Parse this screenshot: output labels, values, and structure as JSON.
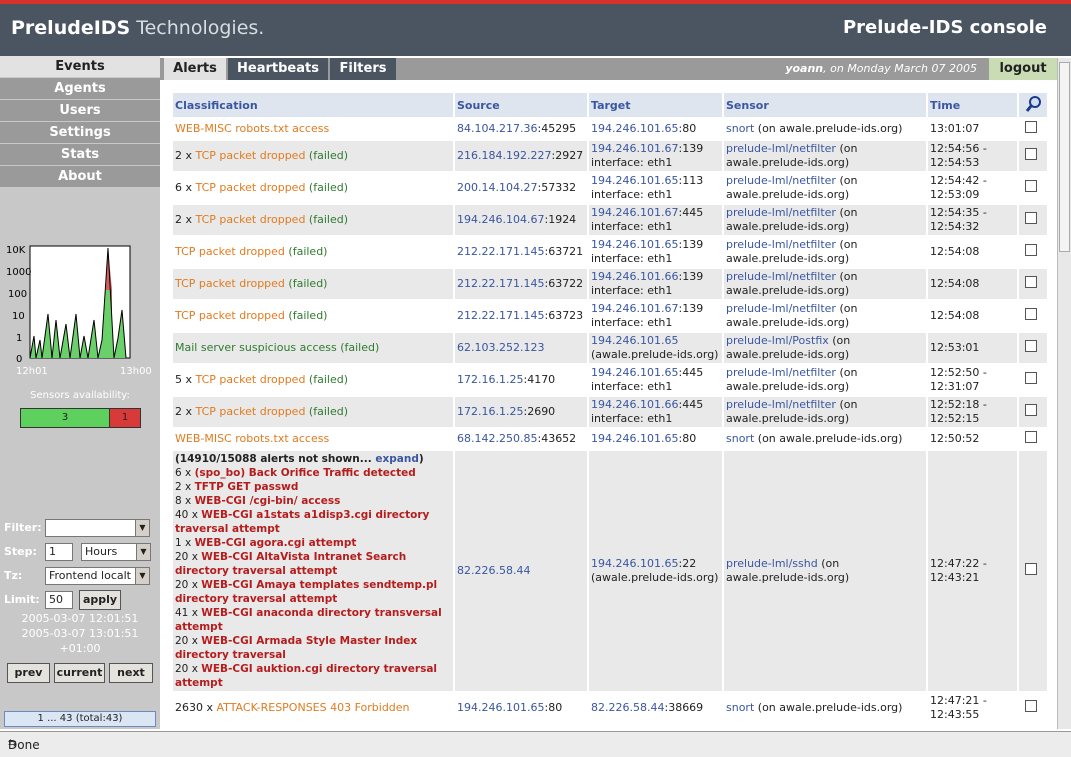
{
  "header": {
    "brand": "PreludeIDS",
    "brand_sub": "Technologies.",
    "console": "Prelude-IDS console"
  },
  "nav": [
    "Events",
    "Agents",
    "Users",
    "Settings",
    "Stats",
    "About"
  ],
  "graph": {
    "yticks": [
      "10K",
      "1000",
      "100",
      "10",
      "1",
      "0"
    ],
    "xstart": "12h01",
    "xend": "13h00"
  },
  "availability": {
    "label": "Sensors availability:",
    "ok": "3",
    "bad": "1"
  },
  "filters": {
    "filter_label": "Filter:",
    "filter_value": "",
    "step_label": "Step:",
    "step_value": "1",
    "step_unit": "Hours",
    "tz_label": "Tz:",
    "tz_value": "Frontend localt",
    "limit_label": "Limit:",
    "limit_value": "50",
    "apply": "apply",
    "date_from": "2005-03-07 12:01:51",
    "date_to": "2005-03-07 13:01:51",
    "tz_offset": "+01:00",
    "prev": "prev",
    "current": "current",
    "next": "next",
    "pager": "1 ... 43 (total:43)"
  },
  "tabs": [
    "Alerts",
    "Heartbeats",
    "Filters"
  ],
  "user": {
    "name": "yoann",
    "date": ", on Monday March 07 2005",
    "logout": "logout"
  },
  "columns": [
    "Classification",
    "Source",
    "Target",
    "Sensor",
    "Time"
  ],
  "rows": [
    {
      "cnt": "",
      "cls": "WEB-MISC robots.txt access",
      "failed": "",
      "src": "84.104.217.36",
      "sport": ":45295",
      "tgt": "194.246.101.65",
      "tport": ":80",
      "tsub": "",
      "sensor": "snort",
      "snote": " (on awale.prelude-ids.org)",
      "t1": "13:01:07",
      "t2": ""
    },
    {
      "cnt": "2 x ",
      "cls": "TCP packet dropped",
      "failed": " (failed)",
      "src": "216.184.192.227",
      "sport": ":2927",
      "tgt": "194.246.101.67",
      "tport": ":139",
      "tsub": "interface: eth1",
      "sensor": "prelude-lml/netfilter",
      "snote": " (on awale.prelude-ids.org)",
      "t1": "12:54:56 -",
      "t2": "12:54:53"
    },
    {
      "cnt": "6 x ",
      "cls": "TCP packet dropped",
      "failed": " (failed)",
      "src": "200.14.104.27",
      "sport": ":57332",
      "tgt": "194.246.101.65",
      "tport": ":113",
      "tsub": "interface: eth1",
      "sensor": "prelude-lml/netfilter",
      "snote": " (on awale.prelude-ids.org)",
      "t1": "12:54:42 -",
      "t2": "12:53:09"
    },
    {
      "cnt": "2 x ",
      "cls": "TCP packet dropped",
      "failed": " (failed)",
      "src": "194.246.104.67",
      "sport": ":1924",
      "tgt": "194.246.101.67",
      "tport": ":445",
      "tsub": "interface: eth1",
      "sensor": "prelude-lml/netfilter",
      "snote": " (on awale.prelude-ids.org)",
      "t1": "12:54:35 -",
      "t2": "12:54:32"
    },
    {
      "cnt": "",
      "cls": "TCP packet dropped",
      "failed": " (failed)",
      "src": "212.22.171.145",
      "sport": ":63721",
      "tgt": "194.246.101.65",
      "tport": ":139",
      "tsub": "interface: eth1",
      "sensor": "prelude-lml/netfilter",
      "snote": " (on awale.prelude-ids.org)",
      "t1": "12:54:08",
      "t2": ""
    },
    {
      "cnt": "",
      "cls": "TCP packet dropped",
      "failed": " (failed)",
      "src": "212.22.171.145",
      "sport": ":63722",
      "tgt": "194.246.101.66",
      "tport": ":139",
      "tsub": "interface: eth1",
      "sensor": "prelude-lml/netfilter",
      "snote": " (on awale.prelude-ids.org)",
      "t1": "12:54:08",
      "t2": ""
    },
    {
      "cnt": "",
      "cls": "TCP packet dropped",
      "failed": " (failed)",
      "src": "212.22.171.145",
      "sport": ":63723",
      "tgt": "194.246.101.67",
      "tport": ":139",
      "tsub": "interface: eth1",
      "sensor": "prelude-lml/netfilter",
      "snote": " (on awale.prelude-ids.org)",
      "t1": "12:54:08",
      "t2": ""
    },
    {
      "cnt": "",
      "cls": "",
      "failed": "Mail server suspicious access (failed)",
      "src": "62.103.252.123",
      "sport": "",
      "tgt": "194.246.101.65",
      "tport": "",
      "tsub": "(awale.prelude-ids.org)",
      "sensor": "prelude-lml/Postfix",
      "snote": " (on awale.prelude-ids.org)",
      "t1": "12:53:01",
      "t2": ""
    },
    {
      "cnt": "5 x ",
      "cls": "TCP packet dropped",
      "failed": " (failed)",
      "src": "172.16.1.25",
      "sport": ":4170",
      "tgt": "194.246.101.65",
      "tport": ":445",
      "tsub": "interface: eth1",
      "sensor": "prelude-lml/netfilter",
      "snote": " (on awale.prelude-ids.org)",
      "t1": "12:52:50 -",
      "t2": "12:31:07"
    },
    {
      "cnt": "2 x ",
      "cls": "TCP packet dropped",
      "failed": " (failed)",
      "src": "172.16.1.25",
      "sport": ":2690",
      "tgt": "194.246.101.66",
      "tport": ":445",
      "tsub": "interface: eth1",
      "sensor": "prelude-lml/netfilter",
      "snote": " (on awale.prelude-ids.org)",
      "t1": "12:52:18 -",
      "t2": "12:52:15"
    },
    {
      "cnt": "",
      "cls": "WEB-MISC robots.txt access",
      "failed": "",
      "src": "68.142.250.85",
      "sport": ":43652",
      "tgt": "194.246.101.65",
      "tport": ":80",
      "tsub": "",
      "sensor": "snort",
      "snote": " (on awale.prelude-ids.org)",
      "t1": "12:50:52",
      "t2": ""
    }
  ],
  "group": {
    "header": "(14910/15088 alerts not shown...",
    "expand": "expand",
    "close": ")",
    "items": [
      {
        "cnt": "6 x ",
        "name": "(spo_bo) Back Orifice Traffic detected"
      },
      {
        "cnt": "2 x ",
        "name": "TFTP GET passwd"
      },
      {
        "cnt": "8 x ",
        "name": "WEB-CGI /cgi-bin/ access"
      },
      {
        "cnt": "40 x ",
        "name": "WEB-CGI a1stats a1disp3.cgi directory traversal attempt"
      },
      {
        "cnt": "1 x ",
        "name": "WEB-CGI agora.cgi attempt"
      },
      {
        "cnt": "20 x ",
        "name": "WEB-CGI AltaVista Intranet Search directory traversal attempt"
      },
      {
        "cnt": "20 x ",
        "name": "WEB-CGI Amaya templates sendtemp.pl directory traversal attempt"
      },
      {
        "cnt": "41 x ",
        "name": "WEB-CGI anaconda directory transversal attempt"
      },
      {
        "cnt": "20 x ",
        "name": "WEB-CGI Armada Style Master Index directory traversal"
      },
      {
        "cnt": "20 x ",
        "name": "WEB-CGI auktion.cgi directory traversal attempt"
      }
    ],
    "src": "82.226.58.44",
    "tgt": "194.246.101.65",
    "tport": ":22",
    "tsub": "(awale.prelude-ids.org)",
    "sensor": "prelude-lml/sshd",
    "snote": " (on awale.prelude-ids.org)",
    "t1": "12:47:22 -",
    "t2": "12:43:21"
  },
  "lastrow": {
    "cnt": "2630 x ",
    "cls": "ATTACK-RESPONSES 403 Forbidden",
    "src": "194.246.101.65",
    "sport": ":80",
    "tgt": "82.226.58.44",
    "tport": ":38669",
    "sensor": "snort",
    "snote": " (on awale.prelude-ids.org)",
    "t1": "12:47:21 -",
    "t2": "12:43:55"
  },
  "status": "Done"
}
